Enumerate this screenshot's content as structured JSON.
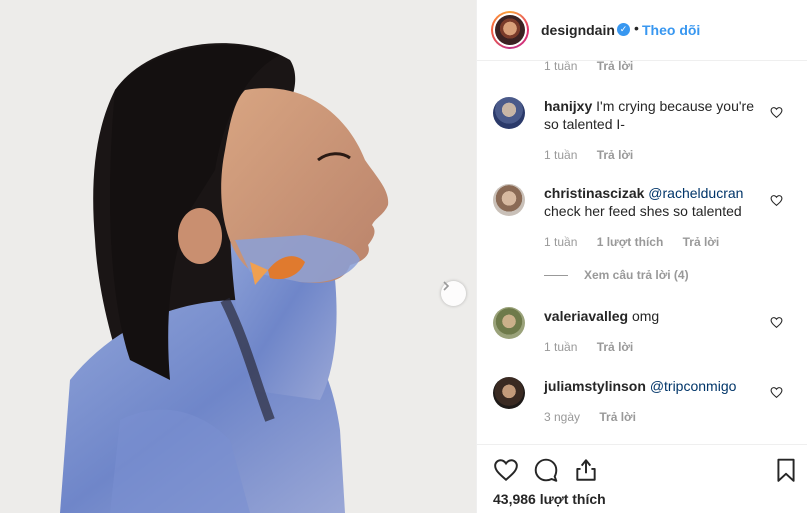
{
  "post": {
    "next_icon": "chevron-right-icon"
  },
  "header": {
    "username": "designdain",
    "verified_icon": "verified-badge-icon",
    "separator": "•",
    "follow_label": "Theo dõi"
  },
  "top_meta": {
    "time": "1 tuần",
    "reply": "Trả lời"
  },
  "comments": [
    {
      "username": "hanijxy",
      "text": "I'm crying because you're so talented I-",
      "time": "1 tuần",
      "likes": "",
      "reply": "Trả lời"
    },
    {
      "username": "christinascizak",
      "mention": "@rachelducran",
      "text": "check her feed shes so talented",
      "time": "1 tuần",
      "likes": "1 lượt thích",
      "reply": "Trả lời",
      "view_replies": "Xem câu trả lời (4)"
    },
    {
      "username": "valeriavalleg",
      "text": "omg",
      "time": "1 tuần",
      "likes": "",
      "reply": "Trả lời"
    },
    {
      "username": "juliamstylinson",
      "mention": "@tripconmigo",
      "text": "",
      "time": "3 ngày",
      "likes": "",
      "reply": "Trả lời"
    }
  ],
  "actions": {
    "like_icon": "heart-icon",
    "comment_icon": "comment-icon",
    "share_icon": "share-icon",
    "save_icon": "bookmark-icon",
    "likes_count": "43,986 lượt thích"
  },
  "colors": {
    "link_blue": "#3897f0",
    "mention_blue": "#003569",
    "text": "#262626",
    "muted": "#999999",
    "border": "#efefef"
  }
}
